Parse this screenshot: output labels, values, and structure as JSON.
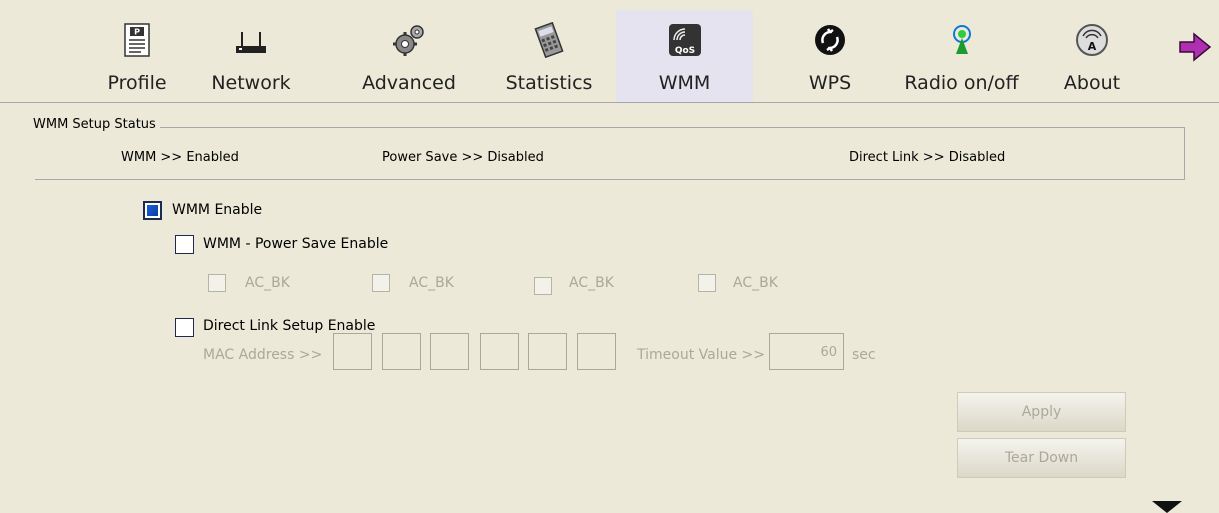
{
  "toolbar": {
    "items": [
      {
        "label": "Profile",
        "icon": "profile-icon"
      },
      {
        "label": "Network",
        "icon": "router-icon"
      },
      {
        "label": "Advanced",
        "icon": "gears-icon"
      },
      {
        "label": "Statistics",
        "icon": "calculator-icon"
      },
      {
        "label": "WMM",
        "icon": "qos-icon"
      },
      {
        "label": "WPS",
        "icon": "wps-icon"
      },
      {
        "label": "Radio on/off",
        "icon": "radio-icon"
      },
      {
        "label": "About",
        "icon": "about-icon"
      }
    ],
    "active": "WMM",
    "next_icon": "arrow-right-icon"
  },
  "status": {
    "title": "WMM Setup Status",
    "wmm": "WMM >> Enabled",
    "power_save": "Power Save >> Disabled",
    "direct_link": "Direct Link >> Disabled"
  },
  "options": {
    "wmm_enable": {
      "label": "WMM Enable",
      "checked": true
    },
    "power_save_enable": {
      "label": "WMM - Power Save Enable",
      "checked": false
    },
    "ac": [
      {
        "label": "AC_BK",
        "checked": false
      },
      {
        "label": "AC_BK",
        "checked": false
      },
      {
        "label": "AC_BK",
        "checked": false
      },
      {
        "label": "AC_BK",
        "checked": false
      }
    ],
    "direct_link_enable": {
      "label": "Direct Link Setup Enable",
      "checked": false
    },
    "mac_label": "MAC Address >>",
    "mac_values": [
      "",
      "",
      "",
      "",
      "",
      ""
    ],
    "timeout_label": "Timeout Value >>",
    "timeout_value": "60",
    "timeout_unit": "sec"
  },
  "buttons": {
    "apply": "Apply",
    "tear_down": "Tear Down"
  }
}
